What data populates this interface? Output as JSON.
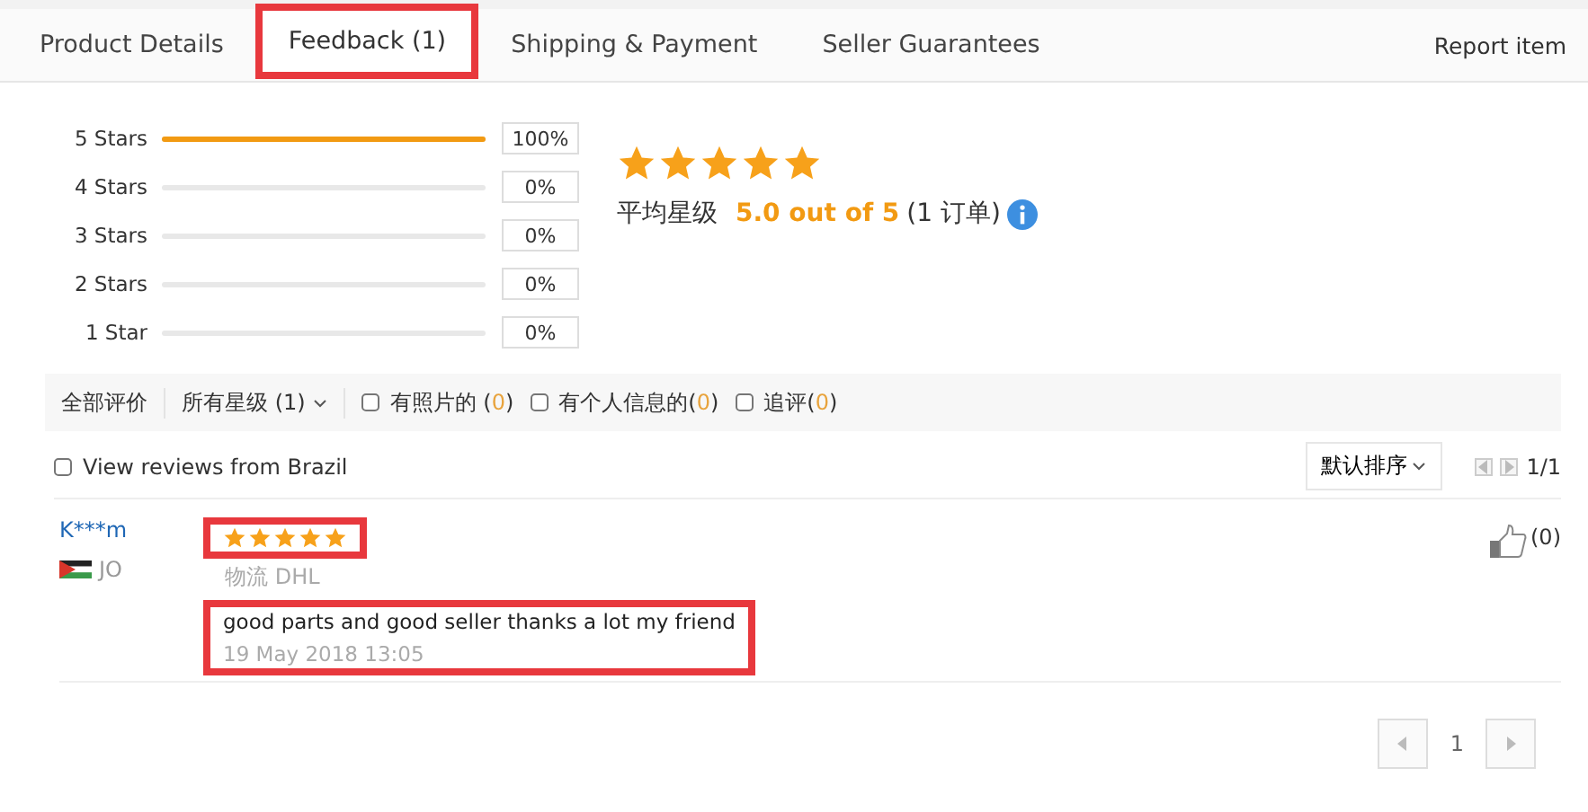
{
  "tabs": [
    {
      "label": "Product Details",
      "selected": false,
      "highlighted": false
    },
    {
      "label": "Feedback (1)",
      "selected": true,
      "highlighted": true
    },
    {
      "label": "Shipping & Payment",
      "selected": false,
      "highlighted": false
    },
    {
      "label": "Seller Guarantees",
      "selected": false,
      "highlighted": false
    }
  ],
  "report_link": "Report item",
  "distribution": [
    {
      "label": "5 Stars",
      "level": 1,
      "percent": "100%"
    },
    {
      "label": "4 Stars",
      "level": 0,
      "percent": "0%"
    },
    {
      "label": "3 Stars",
      "level": 0,
      "percent": "0%"
    },
    {
      "label": "2 Stars",
      "level": 0,
      "percent": "0%"
    },
    {
      "label": "1 Star",
      "level": 0,
      "percent": "0%"
    }
  ],
  "summary": {
    "stars": 5,
    "label": "平均星级",
    "score": "5.0 out of 5",
    "orders": "(1 订单)"
  },
  "filters": {
    "all": "全部评价",
    "star_filter": "所有星级 (1)",
    "options": [
      {
        "label": "有照片的 (",
        "count": "0",
        "close": ")",
        "checked": false
      },
      {
        "label": "有个人信息的(",
        "count": "0",
        "close": ")",
        "checked": false
      },
      {
        "label": "追评(",
        "count": "0",
        "close": ")",
        "checked": false
      }
    ]
  },
  "region_filter": {
    "label": "View reviews from Brazil",
    "checked": false
  },
  "sort": "默认排序",
  "page_indicator": "1/1",
  "reviews": [
    {
      "name": "K***m",
      "country": "JO",
      "stars": 5,
      "stars_highlighted": true,
      "logistics_label": "物流",
      "logistics": "DHL",
      "text": "good parts and good seller thanks a lot my friend",
      "date": "19 May 2018 13:05",
      "text_highlighted": true,
      "likes": "(0)"
    }
  ],
  "pagination": [
    {
      "label": "1",
      "selected": true
    }
  ]
}
